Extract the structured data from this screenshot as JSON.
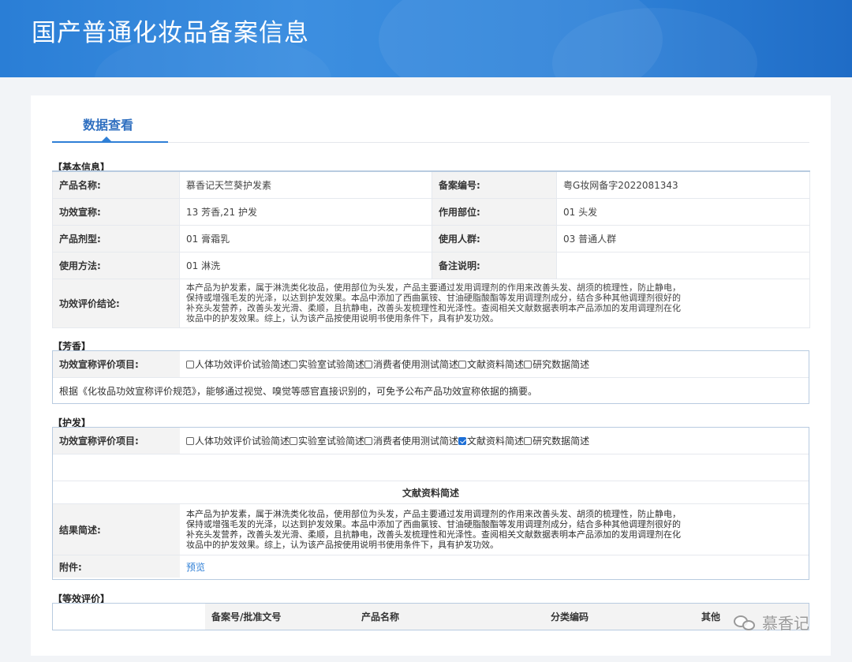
{
  "header": {
    "title": "国产普通化妆品备案信息"
  },
  "tabs": [
    {
      "label": "数据查看"
    }
  ],
  "basic": {
    "section_title": "【基本信息】",
    "product_name_label": "产品名称:",
    "product_name": "慕香记天竺葵护发素",
    "record_no_label": "备案编号:",
    "record_no": "粤G妆网备字2022081343",
    "claim_label": "功效宣称:",
    "claim": "13 芳香,21 护发",
    "part_label": "作用部位:",
    "part": "01 头发",
    "form_label": "产品剂型:",
    "form": "01 膏霜乳",
    "people_label": "使用人群:",
    "people": "03 普通人群",
    "usage_label": "使用方法:",
    "usage": "01 淋洗",
    "remark_label": "备注说明:",
    "remark": "",
    "conclusion_label": "功效评价结论:",
    "conclusion": "本产品为护发素，属于淋洗类化妆品，使用部位为头发，产品主要通过发用调理剂的作用来改善头发、胡须的梳理性，防止静电，保持或增强毛发的光泽，以达到护发效果。本品中添加了西曲氯铵、甘油硬脂酸酯等发用调理剂成分，结合多种其他调理剂很好的补充头发营养，改善头发光滑、柔顺，且抗静电，改善头发梳理性和光泽性。查阅相关文献数据表明本产品添加的发用调理剂在化妆品中的护发效果。综上，认为该产品按使用说明书使用条件下，具有护发功效。"
  },
  "fragrance": {
    "section_title": "【芳香】",
    "eval_label": "功效宣称评价项目:",
    "options": [
      {
        "label": "人体功效评价试验简述",
        "checked": false
      },
      {
        "label": "实验室试验简述",
        "checked": false
      },
      {
        "label": "消费者使用测试简述",
        "checked": false
      },
      {
        "label": "文献资料简述",
        "checked": false
      },
      {
        "label": "研究数据简述",
        "checked": false
      }
    ],
    "note": "根据《化妆品功效宣称评价规范》，能够通过视觉、嗅觉等感官直接识别的，可免予公布产品功效宣称依据的摘要。"
  },
  "haircare": {
    "section_title": "【护发】",
    "eval_label": "功效宣称评价项目:",
    "options": [
      {
        "label": "人体功效评价试验简述",
        "checked": false
      },
      {
        "label": "实验室试验简述",
        "checked": false
      },
      {
        "label": "消费者使用测试简述",
        "checked": false
      },
      {
        "label": "文献资料简述",
        "checked": true
      },
      {
        "label": "研究数据简述",
        "checked": false
      }
    ],
    "subheading": "文献资料简述",
    "result_label": "结果简述:",
    "result": "本产品为护发素，属于淋洗类化妆品，使用部位为头发，产品主要通过发用调理剂的作用来改善头发、胡须的梳理性，防止静电，保持或增强毛发的光泽，以达到护发效果。本品中添加了西曲氯铵、甘油硬脂酸酯等发用调理剂成分，结合多种其他调理剂很好的补充头发营养，改善头发光滑、柔顺，且抗静电，改善头发梳理性和光泽性。查阅相关文献数据表明本产品添加的发用调理剂在化妆品中的护发效果。综上，认为该产品按使用说明书使用条件下，具有护发功效。",
    "attach_label": "附件:",
    "attach_link": "预览"
  },
  "equivalent": {
    "section_title": "【等效评价】",
    "columns": [
      "备案号/批准文号",
      "产品名称",
      "分类编码",
      "其他"
    ]
  },
  "watermark": {
    "text": "慕香记"
  }
}
